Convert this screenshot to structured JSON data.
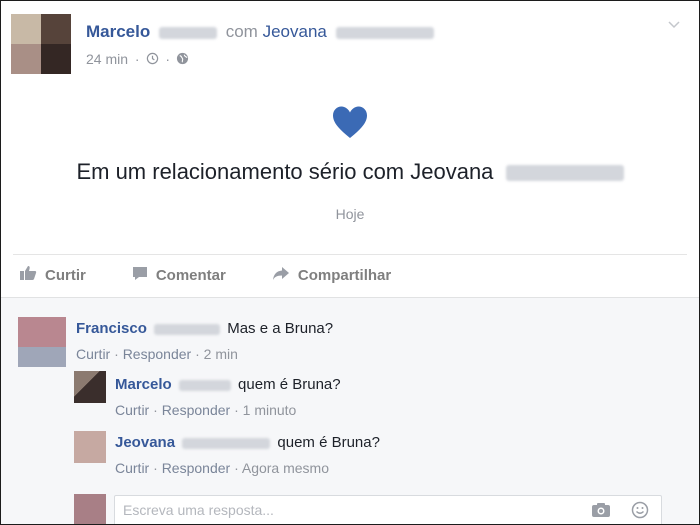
{
  "post": {
    "author": "Marcelo",
    "connector": "com",
    "tagged": "Jeovana",
    "time": "24 min",
    "status_text": "Em um relacionamento sério com Jeovana",
    "date": "Hoje",
    "heart_color": "#3b6ab5"
  },
  "actions": {
    "like": "Curtir",
    "comment": "Comentar",
    "share": "Compartilhar"
  },
  "comments": [
    {
      "name": "Francisco",
      "text": "Mas e a Bruna?",
      "like": "Curtir",
      "reply": "Responder",
      "time": "2 min"
    },
    {
      "name": "Marcelo",
      "text": "quem é Bruna?",
      "like": "Curtir",
      "reply": "Responder",
      "time": "1 minuto"
    },
    {
      "name": "Jeovana",
      "text": "quem é Bruna?",
      "like": "Curtir",
      "reply": "Responder",
      "time": "Agora mesmo"
    }
  ],
  "reply_input": {
    "placeholder": "Escreva uma resposta..."
  },
  "colors": {
    "link": "#365899",
    "muted": "#90949c",
    "comments_bg": "#f6f7f9"
  }
}
